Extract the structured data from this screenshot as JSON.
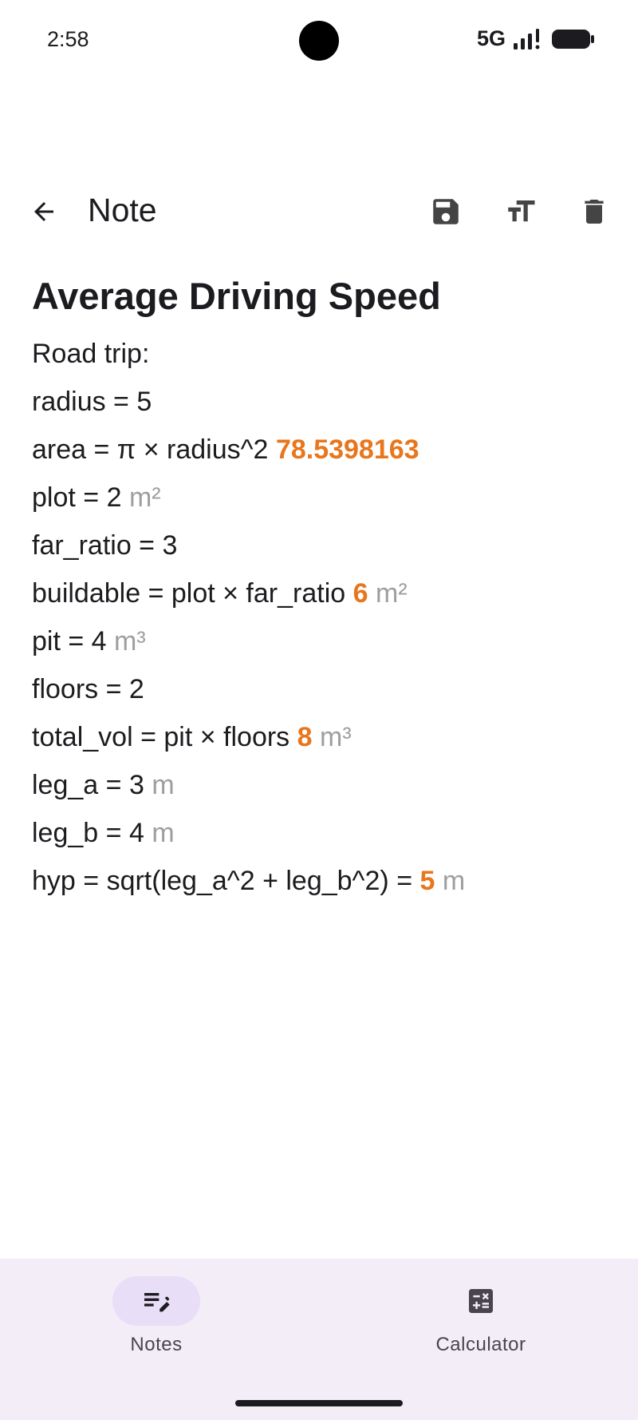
{
  "status_bar": {
    "time": "2:58",
    "network": "5G"
  },
  "app_bar": {
    "title": "Note",
    "icons": [
      "back-arrow-icon",
      "save-icon",
      "text-size-icon",
      "delete-icon"
    ]
  },
  "note": {
    "title": "Average Driving Speed",
    "lines": [
      {
        "expr": "Road trip:",
        "result": "",
        "unit": ""
      },
      {
        "expr": "radius = 5",
        "result": "",
        "unit": ""
      },
      {
        "expr": "area = π × radius^2",
        "result": "78.5398163",
        "unit": ""
      },
      {
        "expr": "plot = 2",
        "result": "",
        "unit": "m²"
      },
      {
        "expr": "far_ratio = 3",
        "result": "",
        "unit": ""
      },
      {
        "expr": "buildable = plot × far_ratio",
        "result": "6",
        "unit": "m²"
      },
      {
        "expr": "pit = 4",
        "result": "",
        "unit": "m³"
      },
      {
        "expr": "floors = 2",
        "result": "",
        "unit": ""
      },
      {
        "expr": "total_vol = pit × floors",
        "result": "8",
        "unit": "m³"
      },
      {
        "expr": "leg_a = 3",
        "result": "",
        "unit": "m"
      },
      {
        "expr": "leg_b = 4",
        "result": "",
        "unit": "m"
      },
      {
        "expr": "hyp = sqrt(leg_a^2 + leg_b^2) =",
        "result": "5",
        "unit": "m"
      }
    ]
  },
  "bottom_nav": {
    "items": [
      {
        "label": "Notes",
        "icon": "notes-edit-icon",
        "active": true
      },
      {
        "label": "Calculator",
        "icon": "calculator-icon",
        "active": false
      }
    ]
  },
  "colors": {
    "accent_result": "#e8761c",
    "unit_gray": "#9e9e9e",
    "nav_background": "#f3edf7",
    "nav_active_indicator": "#e8def8"
  }
}
